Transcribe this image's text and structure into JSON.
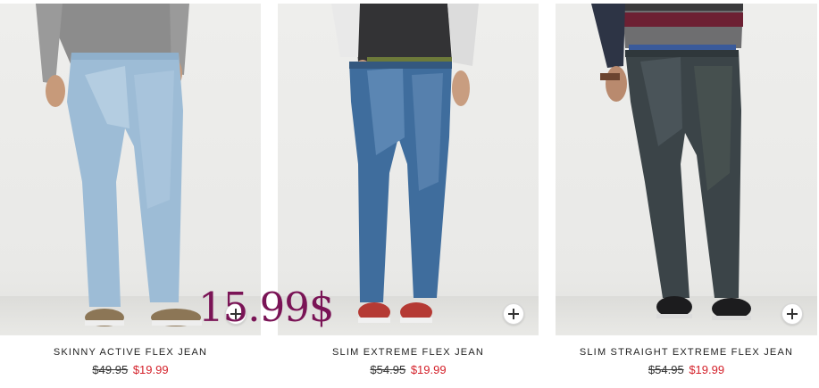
{
  "products": [
    {
      "name": "SKINNY ACTIVE FLEX JEAN",
      "original_price": "$49.95",
      "sale_price": "$19.99",
      "image_icon": "jeans-model-photo",
      "add_icon": "plus-icon"
    },
    {
      "name": "SLIM EXTREME FLEX JEAN",
      "original_price": "$54.95",
      "sale_price": "$19.99",
      "image_icon": "jeans-model-photo",
      "add_icon": "plus-icon"
    },
    {
      "name": "SLIM STRAIGHT EXTREME FLEX JEAN",
      "original_price": "$54.95",
      "sale_price": "$19.99",
      "image_icon": "jeans-model-photo",
      "add_icon": "plus-icon"
    }
  ],
  "overlay": {
    "text": "15.99$"
  },
  "colors": {
    "sale": "#d4212a",
    "overlay": "#7a1456"
  }
}
